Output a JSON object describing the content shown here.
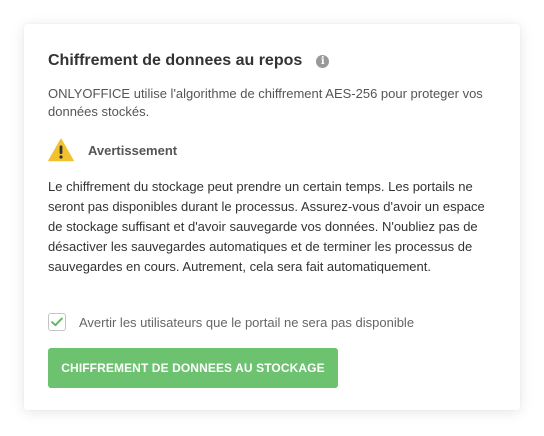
{
  "card": {
    "title": "Chiffrement de donnees au repos",
    "info_icon": "info-icon",
    "description": "ONLYOFFICE utilise l'algorithme de chiffrement AES-256 pour proteger vos données stockés.",
    "warning": {
      "icon": "warning-triangle-icon",
      "title": "Avertissement",
      "text": "Le chiffrement du stockage peut prendre un certain temps. Les portails ne seront pas disponibles durant le processus. Assurez-vous d'avoir un espace de stockage suffisant et d'avoir sauvegarde vos données. N'oubliez pas de désactiver les sauvegardes automatiques et de terminer les processus de sauvegardes en cours. Autrement, cela sera fait automatiquement."
    },
    "notify_checkbox": {
      "label": "Avertir les utilisateurs que le portail ne sera pas disponible",
      "checked": true
    },
    "submit_button": {
      "label": "CHIFFREMENT DE DONNEES AU STOCKAGE"
    }
  },
  "colors": {
    "accent_green": "#6cc26f",
    "check_green": "#5fb85f",
    "warning_yellow": "#f2c12e"
  }
}
